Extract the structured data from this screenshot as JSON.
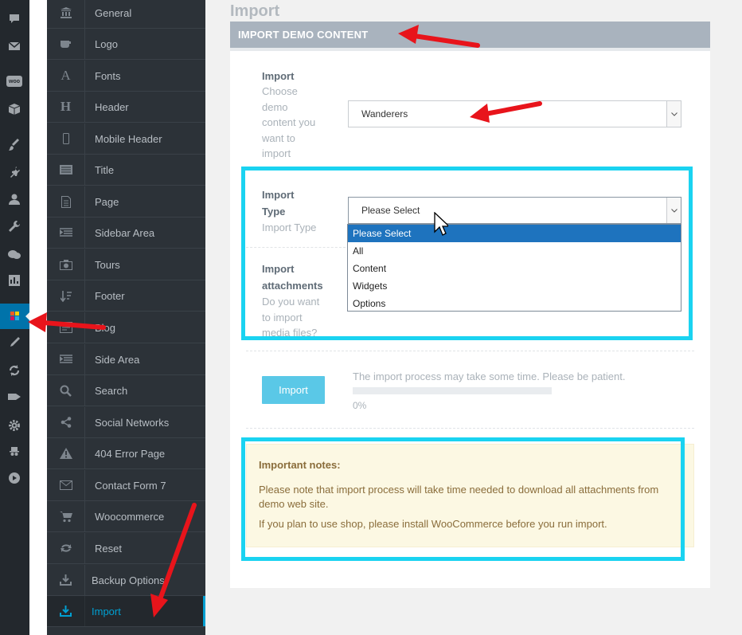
{
  "admin_bar": {
    "icons": [
      "comments-icon",
      "mail-icon",
      "woocommerce-icon",
      "box-icon",
      "brush-icon",
      "plugin-icon",
      "user-icon",
      "wrench-icon",
      "chat-icon",
      "stats-icon",
      "theme-options-icon",
      "pen-icon",
      "refresh-icon",
      "tag-icon",
      "gear-icon",
      "spy-icon",
      "play-icon"
    ],
    "woo_text": "woo"
  },
  "sidebar": {
    "items": [
      {
        "label": "General",
        "icon": "bank-icon"
      },
      {
        "label": "Logo",
        "icon": "coffee-icon"
      },
      {
        "label": "Fonts",
        "icon": "font-icon"
      },
      {
        "label": "Header",
        "icon": "header-icon"
      },
      {
        "label": "Mobile Header",
        "icon": "mobile-icon"
      },
      {
        "label": "Title",
        "icon": "title-icon"
      },
      {
        "label": "Page",
        "icon": "page-icon"
      },
      {
        "label": "Sidebar Area",
        "icon": "sidebar-icon"
      },
      {
        "label": "Tours",
        "icon": "camera-icon"
      },
      {
        "label": "Footer",
        "icon": "sort-icon"
      },
      {
        "label": "Blog",
        "icon": "blog-icon"
      },
      {
        "label": "Side Area",
        "icon": "side-area-icon"
      },
      {
        "label": "Search",
        "icon": "search-icon"
      },
      {
        "label": "Social Networks",
        "icon": "share-icon"
      },
      {
        "label": "404 Error Page",
        "icon": "warning-icon"
      },
      {
        "label": "Contact Form 7",
        "icon": "envelope-icon"
      },
      {
        "label": "Woocommerce",
        "icon": "cart-icon"
      },
      {
        "label": "Reset",
        "icon": "reset-icon"
      },
      {
        "label": "Backup Options",
        "icon": "download-icon"
      },
      {
        "label": "Import",
        "icon": "import-icon"
      }
    ]
  },
  "page": {
    "title": "Import",
    "section_title": "IMPORT DEMO CONTENT"
  },
  "fields": {
    "demo": {
      "title": "Import",
      "desc_lines": [
        "Choose",
        "demo",
        "content you",
        "want to",
        "import"
      ],
      "value": "Wanderers"
    },
    "type": {
      "title_lines": [
        "Import",
        "Type"
      ],
      "desc": "Import Type",
      "value": "Please Select",
      "options": [
        "Please Select",
        "All",
        "Content",
        "Widgets",
        "Options"
      ]
    },
    "attachments": {
      "title_lines": [
        "Import",
        "attachments"
      ],
      "desc_lines": [
        "Do you want",
        "to import",
        "media files?"
      ]
    }
  },
  "import": {
    "button": "Import",
    "message": "The import process may take some time. Please be patient.",
    "progress": 0,
    "progress_label": "0%"
  },
  "notes": {
    "title": "Important notes:",
    "line1a": "Please note that import process will take time needed to download all attachments from",
    "line1b": "demo web site.",
    "line2": "If you plan to use shop, please install WooCommerce before you run import."
  },
  "colors": {
    "accent_cyan": "#1ad3f1",
    "arrow_red": "#e8141b",
    "active_blue": "#00a0d2"
  }
}
